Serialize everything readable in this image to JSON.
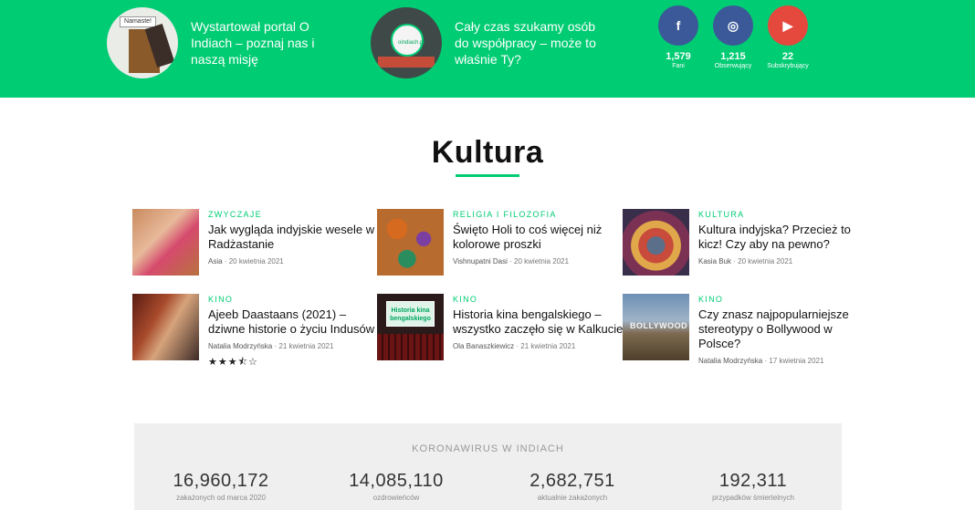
{
  "promos": [
    {
      "text": "Wystartował portal O Indiach – poznaj nas i naszą misję",
      "thumb_text": "Namaste!"
    },
    {
      "text": "Cały czas szukamy osób do współpracy – może to właśnie Ty?",
      "thumb_text": "oindiach.pl"
    }
  ],
  "social": {
    "facebook": {
      "icon": "f",
      "count": "1,579",
      "label": "Fani"
    },
    "instagram": {
      "icon": "◎",
      "count": "1,215",
      "label": "Obserwujący"
    },
    "youtube": {
      "icon": "▶",
      "count": "22",
      "label": "Subskrybujący"
    }
  },
  "section": {
    "title": "Kultura"
  },
  "articles": [
    {
      "category": "Zwyczaje",
      "title": "Jak wygląda indyjskie wesele w Radżastanie",
      "author": "Asia",
      "date": "20 kwietnia 2021"
    },
    {
      "category": "Religia i filozofia",
      "title": "Święto Holi to coś więcej niż kolorowe proszki",
      "author": "Vishnupatni Dasi",
      "date": "20 kwietnia 2021"
    },
    {
      "category": "Kultura",
      "title": "Kultura indyjska? Przecież to kicz! Czy aby na pewno?",
      "author": "Kasia Buk",
      "date": "20 kwietnia 2021"
    },
    {
      "category": "Kino",
      "title": "Ajeeb Daastaans (2021) – dziwne historie o życiu Indusów",
      "author": "Natalia Modrzyńska",
      "date": "21 kwietnia 2021",
      "stars": "★★★⯪☆",
      "rating": 3.5
    },
    {
      "category": "Kino",
      "title": "Historia kina bengalskiego – wszystko zaczęło się w Kalkucie",
      "author": "Ola Banaszkiewicz",
      "date": "21 kwietnia 2021",
      "image_text": "Historia kina bengalskiego"
    },
    {
      "category": "Kino",
      "title": "Czy znasz najpopularniejsze stereotypy o Bollywood w Polsce?",
      "author": "Natalia Modrzyńska",
      "date": "17 kwietnia 2021",
      "image_text": "BOLLYWOOD"
    }
  ],
  "meta_separator": "·",
  "corona": {
    "title": "KORONAWIRUS W INDIACH",
    "stats": [
      {
        "value": "16,960,172",
        "label": "zakażonych od marca 2020"
      },
      {
        "value": "14,085,110",
        "label": "ozdrowieńców"
      },
      {
        "value": "2,682,751",
        "label": "aktualnie zakażonych"
      },
      {
        "value": "192,311",
        "label": "przypadków śmiertelnych"
      }
    ]
  },
  "colors": {
    "accent": "#00cc73",
    "facebook": "#3b5998",
    "instagram": "#3b5998",
    "youtube": "#e5483d"
  }
}
